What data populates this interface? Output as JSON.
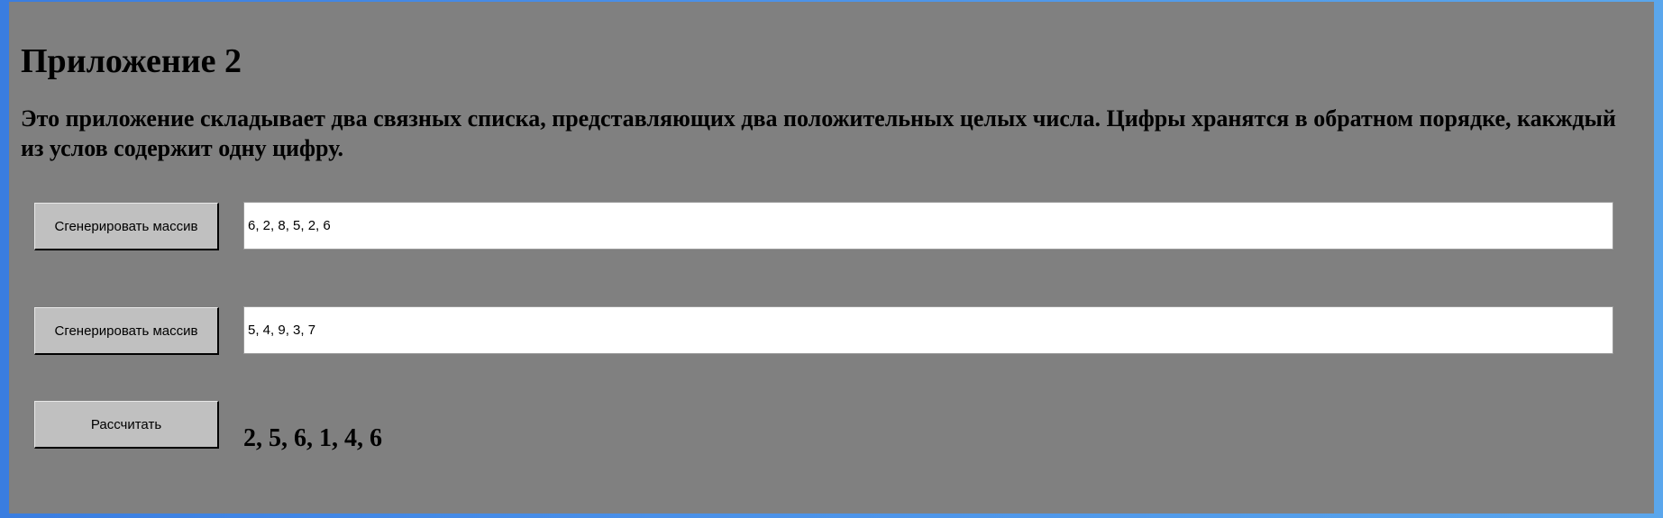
{
  "app": {
    "title": "Приложение 2",
    "description": "Это приложение складывает два связных списка, представляющих два положительных целых числа. Цифры хранятся в обратном порядке, какждый из услов содержит одну цифру."
  },
  "rows": [
    {
      "button_label": "Сгенерировать массив",
      "value": "6, 2, 8, 5, 2, 6"
    },
    {
      "button_label": "Сгенерировать массив",
      "value": "5, 4, 9, 3, 7"
    }
  ],
  "calculate": {
    "button_label": "Рассчитать",
    "result": "2, 5, 6, 1, 4, 6"
  },
  "colors": {
    "panel_background": "#808080",
    "button_background": "#c0c0c0",
    "outer_background": "#4a90e8"
  }
}
